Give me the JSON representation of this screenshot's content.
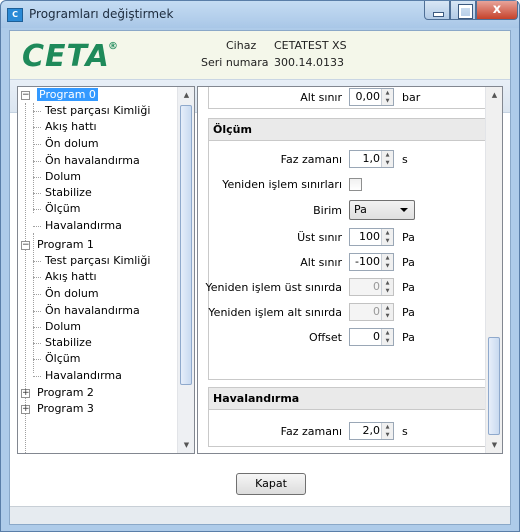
{
  "window": {
    "title": "Programları değiştirmek",
    "close_glyph": "x"
  },
  "header": {
    "logo": "CETA",
    "logo_mark": "®",
    "device_label": "Cihaz",
    "device_value": "CETATEST XS",
    "serial_label": "Seri numara",
    "serial_value": "300.14.0133"
  },
  "toolbar": {
    "icons": [
      "folder-open-icon",
      "save-icon",
      "print-icon",
      "arrow-down-icon",
      "arrow-up-icon"
    ]
  },
  "tree": {
    "programs": [
      {
        "label": "Program 0",
        "expanded": true,
        "selected": true,
        "children": [
          "Test parçası Kimliği",
          "Akış hattı",
          "Ön dolum",
          "Ön havalandırma",
          "Dolum",
          "Stabilize",
          "Ölçüm",
          "Havalandırma"
        ]
      },
      {
        "label": "Program 1",
        "expanded": true,
        "children": [
          "Test parçası Kimliği",
          "Akış hattı",
          "Ön dolum",
          "Ön havalandırma",
          "Dolum",
          "Stabilize",
          "Ölçüm",
          "Havalandırma"
        ]
      },
      {
        "label": "Program 2",
        "expanded": false
      },
      {
        "label": "Program 3",
        "expanded": false
      }
    ]
  },
  "props": {
    "top": {
      "label": "Alt sınır",
      "value": "0,00",
      "unit": "bar"
    },
    "olcum": {
      "title": "Ölçüm",
      "faz_label": "Faz zamanı",
      "faz_value": "1,0",
      "faz_unit": "s",
      "reproc_label": "Yeniden işlem sınırları",
      "birim_label": "Birim",
      "birim_value": "Pa",
      "ust_label": "Üst sınır",
      "ust_value": "100",
      "ust_unit": "Pa",
      "alt_label": "Alt sınır",
      "alt_value": "-100",
      "alt_unit": "Pa",
      "y_ust_label": "Yeniden işlem üst sınırda",
      "y_ust_value": "0",
      "y_ust_unit": "Pa",
      "y_alt_label": "Yeniden işlem alt sınırda",
      "y_alt_value": "0",
      "y_alt_unit": "Pa",
      "offset_label": "Offset",
      "offset_value": "0",
      "offset_unit": "Pa"
    },
    "havalandirma": {
      "title": "Havalandırma",
      "faz_label": "Faz zamanı",
      "faz_value": "2,0",
      "faz_unit": "s"
    }
  },
  "footer": {
    "close_label": "Kapat"
  },
  "colors": {
    "selection": "#3399ff",
    "logo": "#1e8a5a",
    "titlebar": "#aecbe9"
  }
}
